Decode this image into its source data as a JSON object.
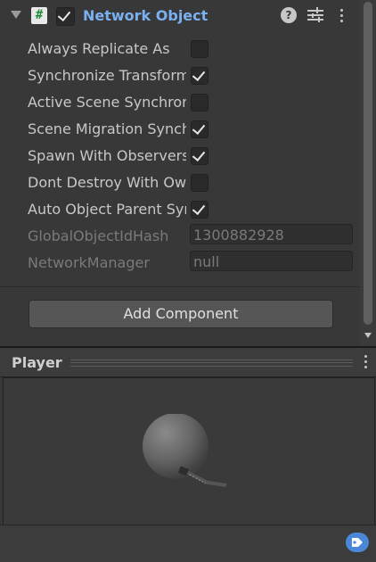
{
  "component": {
    "title": "Network Object",
    "enabled": true,
    "icons": {
      "script": "csharp-script-icon",
      "help": "help-icon",
      "presets": "presets-icon",
      "menu": "kebab-menu-icon"
    }
  },
  "properties": [
    {
      "label": "Always Replicate As",
      "type": "checkbox",
      "checked": false
    },
    {
      "label": "Synchronize Transform",
      "type": "checkbox",
      "checked": true
    },
    {
      "label": "Active Scene Synchronization",
      "type": "checkbox",
      "checked": false
    },
    {
      "label": "Scene Migration Synchronization",
      "type": "checkbox",
      "checked": true
    },
    {
      "label": "Spawn With Observers",
      "type": "checkbox",
      "checked": true
    },
    {
      "label": "Dont Destroy With Owner",
      "type": "checkbox",
      "checked": false
    },
    {
      "label": "Auto Object Parent Sync",
      "type": "checkbox",
      "checked": true
    },
    {
      "label": "GlobalObjectIdHash",
      "type": "readonly",
      "value": "1300882928"
    },
    {
      "label": "NetworkManager",
      "type": "readonly",
      "value": "null"
    }
  ],
  "add_component_label": "Add Component",
  "preview": {
    "title": "Player"
  },
  "colors": {
    "accent": "#7bb0f0",
    "panel": "#383838",
    "tag": "#4a87d9"
  }
}
